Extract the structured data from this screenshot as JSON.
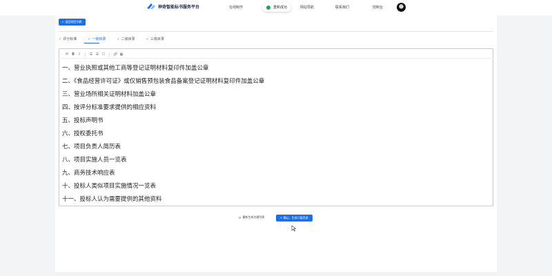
{
  "header": {
    "logo_text": "神奇智能标书服务平台",
    "nav": [
      "在线制作",
      "网站导航",
      "联系我们",
      "控制台"
    ],
    "toast": "重新成功"
  },
  "main": {
    "back_button": "← 返回项目列表",
    "tabs": [
      {
        "label": "评分标准"
      },
      {
        "label": "一级目录"
      },
      {
        "label": "二级目录"
      },
      {
        "label": "三级目录"
      }
    ],
    "toolbar": [
      "H",
      "B",
      "I",
      "☰",
      "☰",
      "☐",
      "🔗",
      "▦"
    ],
    "items": [
      "一、营业执照或其他工商等登记证明材料复印件加盖公章",
      "二、《食品经营许可证》或仅销售预包装食品备案登记证明材料复印件加盖公章",
      "三、营业场所相关证明材料加盖公章",
      "四、按评分标准要求提供的相应资料",
      "五、投标声明书",
      "六、授权委托书",
      "七、项目负责人简历表",
      "八、项目实施人员一览表",
      "九、商务技术响应表",
      "十、投标人类似项目实施情况一览表",
      "十一、投标人认为需要提供的其他资料"
    ],
    "regen_button": "重新生成大纲列表",
    "confirm_button": "+ 确认，生成二级目录"
  }
}
